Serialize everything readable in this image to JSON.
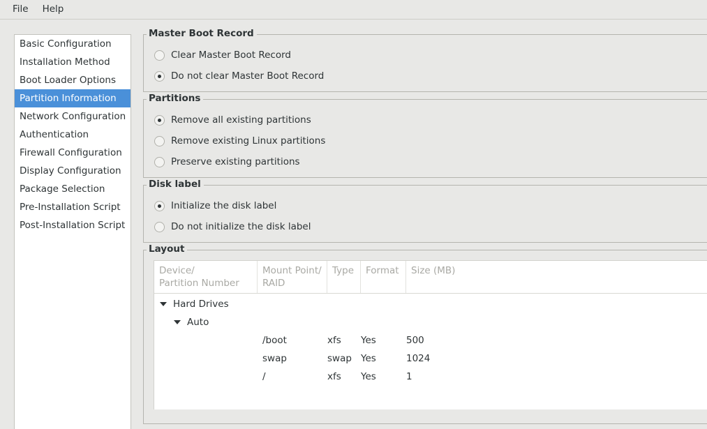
{
  "menubar": {
    "items": [
      {
        "label": "File",
        "name": "menu-file"
      },
      {
        "label": "Help",
        "name": "menu-help"
      }
    ]
  },
  "sidebar": {
    "items": [
      {
        "label": "Basic Configuration",
        "selected": false
      },
      {
        "label": "Installation Method",
        "selected": false
      },
      {
        "label": "Boot Loader Options",
        "selected": false
      },
      {
        "label": "Partition Information",
        "selected": true
      },
      {
        "label": "Network Configuration",
        "selected": false
      },
      {
        "label": "Authentication",
        "selected": false
      },
      {
        "label": "Firewall Configuration",
        "selected": false
      },
      {
        "label": "Display Configuration",
        "selected": false
      },
      {
        "label": "Package Selection",
        "selected": false
      },
      {
        "label": "Pre-Installation Script",
        "selected": false
      },
      {
        "label": "Post-Installation Script",
        "selected": false
      }
    ]
  },
  "groups": {
    "mbr": {
      "title": "Master Boot Record",
      "options": [
        {
          "label": "Clear Master Boot Record",
          "checked": false
        },
        {
          "label": "Do not clear Master Boot Record",
          "checked": true
        }
      ]
    },
    "partitions": {
      "title": "Partitions",
      "options": [
        {
          "label": "Remove all existing partitions",
          "checked": true
        },
        {
          "label": "Remove existing Linux partitions",
          "checked": false
        },
        {
          "label": "Preserve existing partitions",
          "checked": false
        }
      ]
    },
    "disklabel": {
      "title": "Disk label",
      "options": [
        {
          "label": "Initialize the disk label",
          "checked": true
        },
        {
          "label": "Do not initialize the disk label",
          "checked": false
        }
      ]
    },
    "layout": {
      "title": "Layout",
      "columns": [
        "Device/\nPartition Number",
        "Mount Point/\nRAID",
        "Type",
        "Format",
        "Size (MB)"
      ],
      "tree": {
        "root_label": "Hard Drives",
        "child_label": "Auto",
        "rows": [
          {
            "device": "",
            "mount": "/boot",
            "type": "xfs",
            "format": "Yes",
            "size": "500"
          },
          {
            "device": "",
            "mount": "swap",
            "type": "swap",
            "format": "Yes",
            "size": "1024"
          },
          {
            "device": "",
            "mount": "/",
            "type": "xfs",
            "format": "Yes",
            "size": "1"
          }
        ]
      }
    }
  },
  "colors": {
    "background": "#e8e8e6",
    "selection": "#4a90d9",
    "text": "#2e3436",
    "header_text": "#a9a9a4"
  }
}
